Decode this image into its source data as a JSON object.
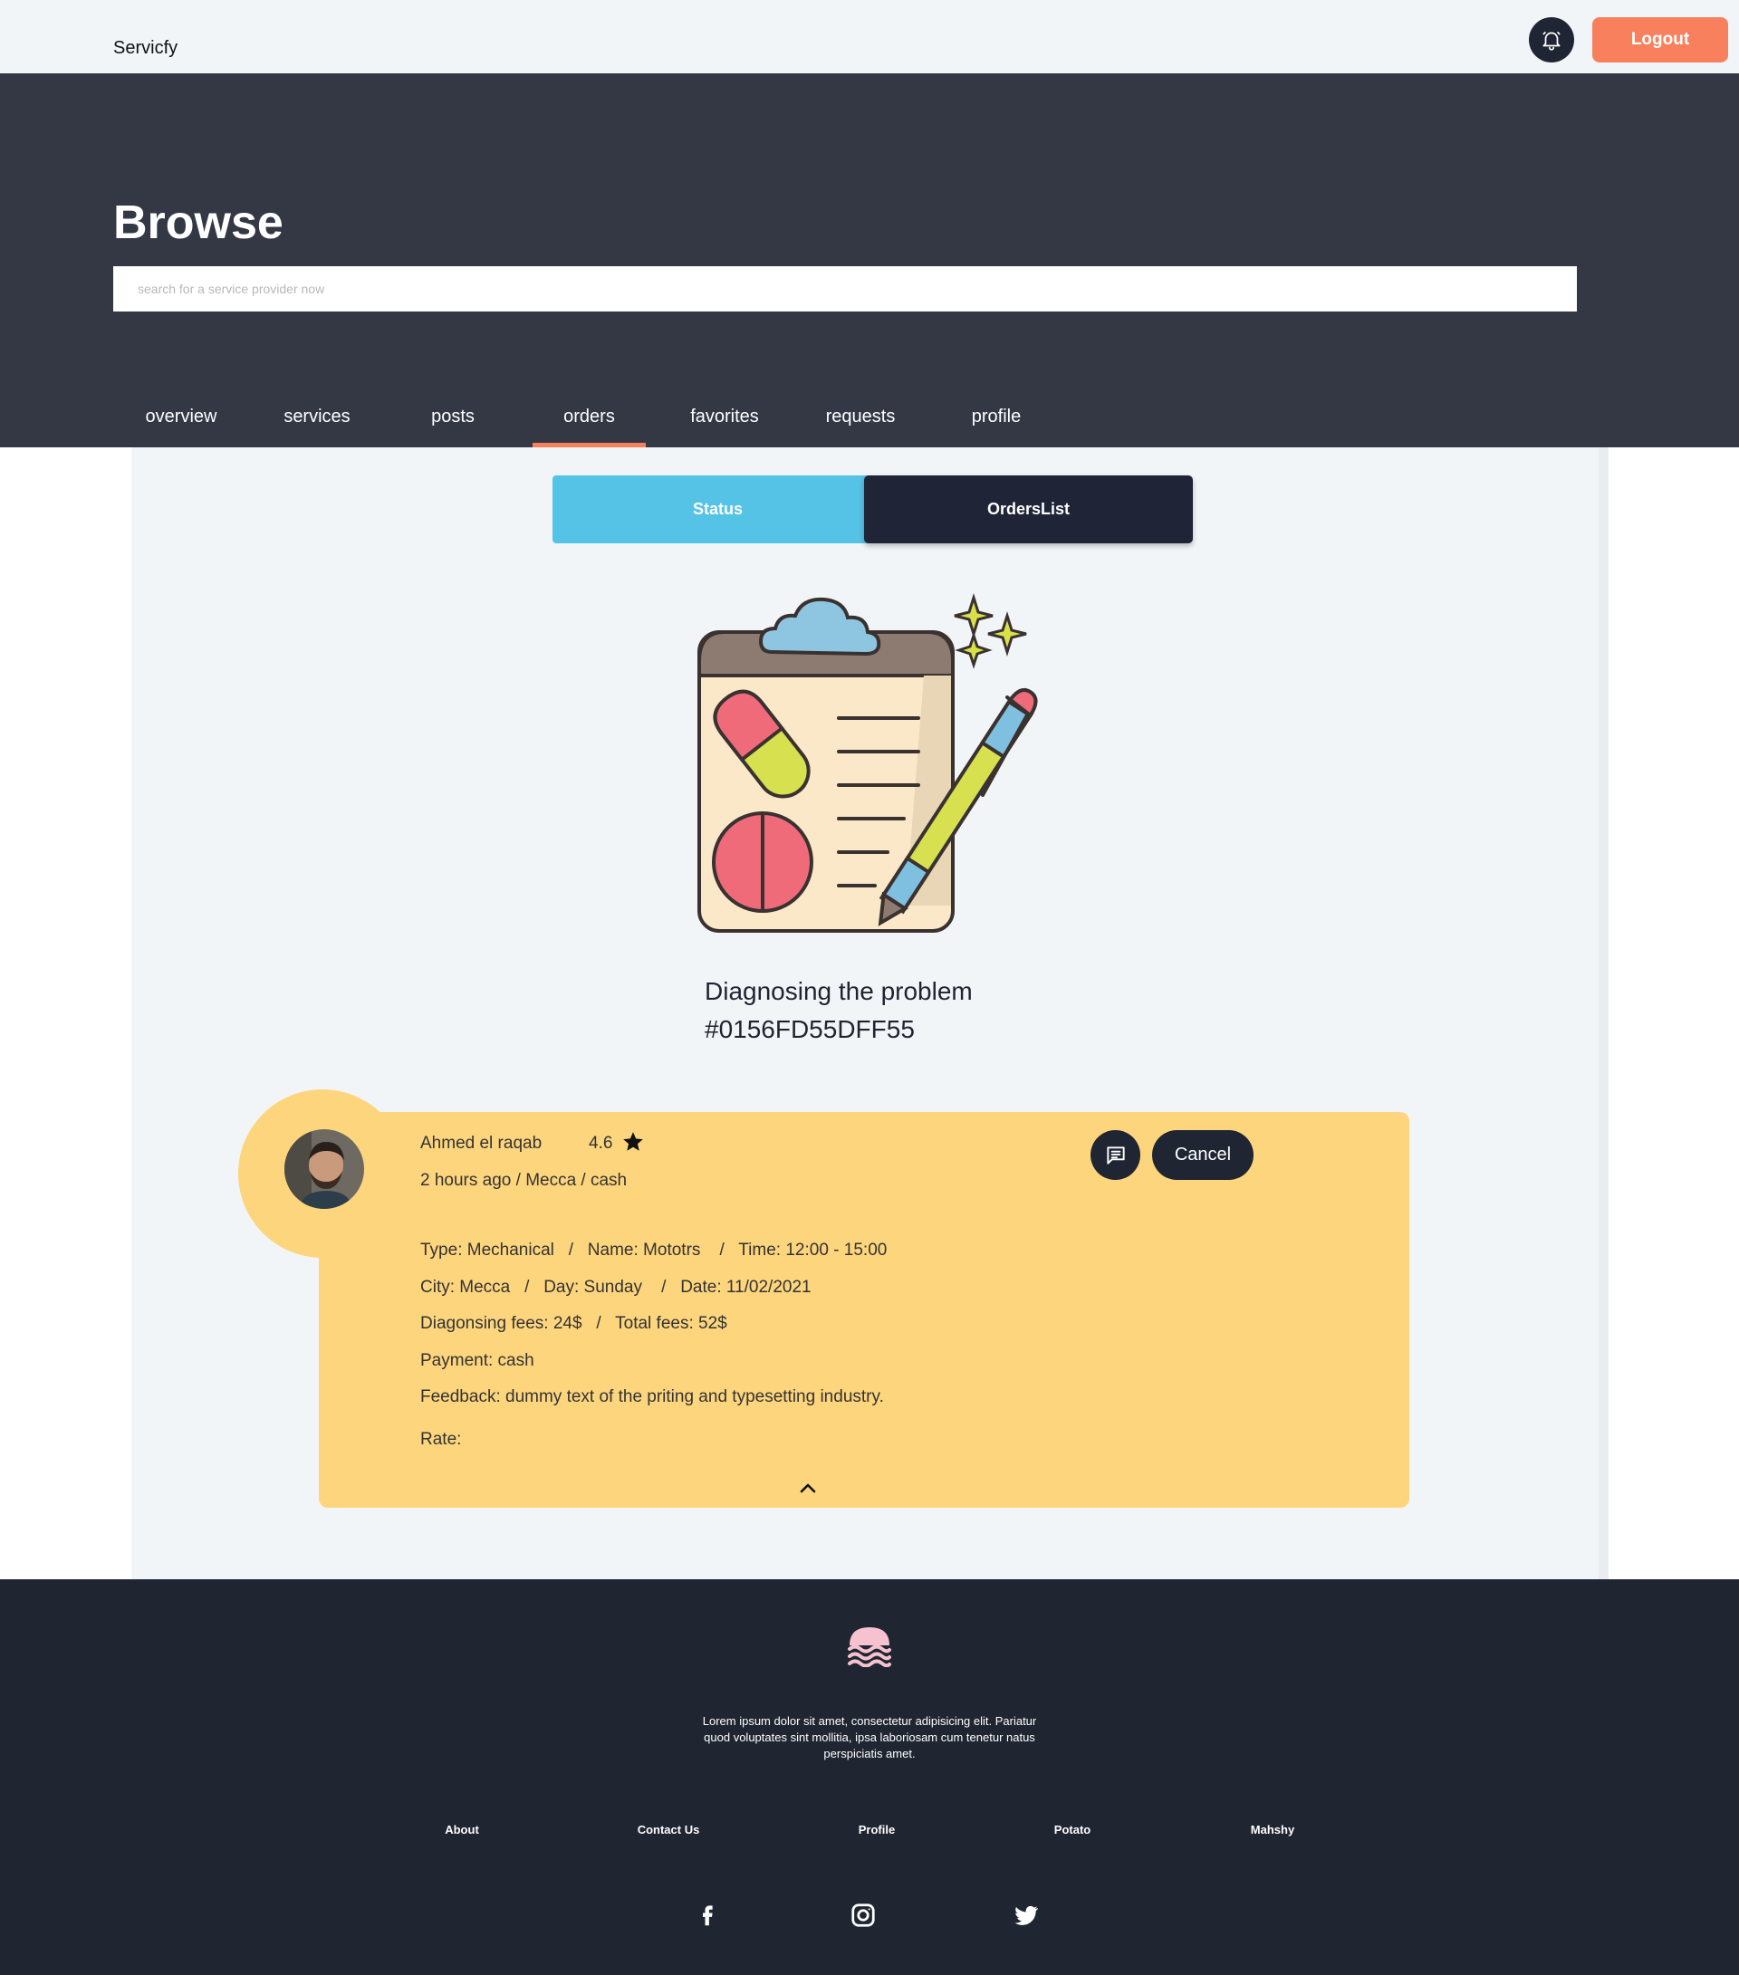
{
  "header": {
    "brand": "Servicfy",
    "logout_label": "Logout"
  },
  "hero": {
    "title": "Browse",
    "search_placeholder": "search for a service provider now"
  },
  "nav": {
    "items": [
      {
        "label": "overview"
      },
      {
        "label": "services"
      },
      {
        "label": "posts"
      },
      {
        "label": "orders"
      },
      {
        "label": "favorites"
      },
      {
        "label": "requests"
      },
      {
        "label": "profile"
      }
    ],
    "active": "orders"
  },
  "tabs": {
    "status_label": "Status",
    "orders_label": "OrdersList"
  },
  "order_status": {
    "title": "Diagnosing the problem",
    "order_id": "#0156FD55DFF55"
  },
  "order": {
    "provider_name": "Ahmed el raqab",
    "rating": "4.6",
    "meta": "2 hours ago / Mecca / cash",
    "cancel_label": "Cancel",
    "details": [
      "Type: Mechanical   /   Name: Mototrs    /   Time: 12:00 - 15:00",
      "City: Mecca   /   Day: Sunday    /   Date: 11/02/2021",
      "Diagonsing fees: 24$   /   Total fees: 52$",
      "Payment: cash",
      "Feedback: dummy text of the priting and typesetting industry.",
      "Rate:"
    ]
  },
  "footer": {
    "description": "Lorem ipsum dolor sit amet, consectetur adipisicing elit. Pariatur quod voluptates sint mollitia, ipsa laboriosam cum tenetur natus perspiciatis amet.",
    "links": [
      {
        "label": "About"
      },
      {
        "label": "Contact Us"
      },
      {
        "label": "Profile"
      },
      {
        "label": "Potato"
      },
      {
        "label": "Mahshy"
      }
    ],
    "social": [
      "facebook-icon",
      "instagram-icon",
      "twitter-icon"
    ]
  },
  "colors": {
    "accent": "#f9805c",
    "status_tab": "#55c3e6",
    "dark": "#1f2532",
    "card": "#fdd57d"
  }
}
